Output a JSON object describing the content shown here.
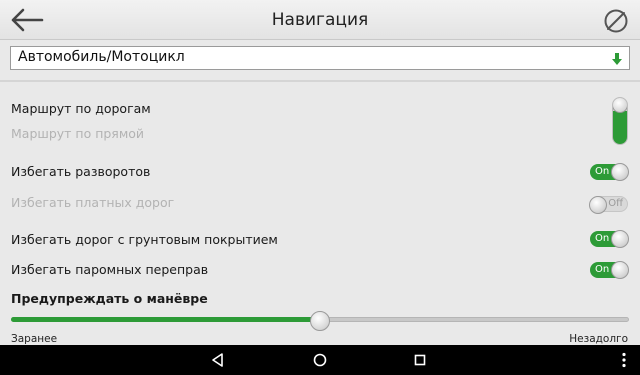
{
  "header": {
    "title": "Навигация"
  },
  "vehicle": {
    "selected": "Автомобиль/Мотоцикл"
  },
  "route": {
    "roads_label": "Маршрут по дорогам",
    "direct_label": "Маршрут по прямой",
    "roads_selected": true
  },
  "options": [
    {
      "label": "Избегать разворотов",
      "state": "On",
      "enabled": true
    },
    {
      "label": "Избегать платных дорог",
      "state": "Off",
      "enabled": false
    },
    {
      "label": "Избегать дорог с грунтовым покрытием",
      "state": "On",
      "enabled": true
    },
    {
      "label": "Избегать паромных переправ",
      "state": "On",
      "enabled": true
    }
  ],
  "maneuver": {
    "label": "Предупреждать о манёвре",
    "min_label": "Заранее",
    "max_label": "Незадолго",
    "value_fraction": 0.5
  },
  "colors": {
    "accent": "#2d9b37"
  },
  "icons": {
    "back": "arrow-left-icon",
    "compass": "compass-off-icon",
    "dropdown": "dropdown-arrow-icon",
    "nav_back": "triangle-back-icon",
    "nav_home": "circle-home-icon",
    "nav_recents": "square-recents-icon",
    "nav_menu": "dots-menu-icon"
  }
}
